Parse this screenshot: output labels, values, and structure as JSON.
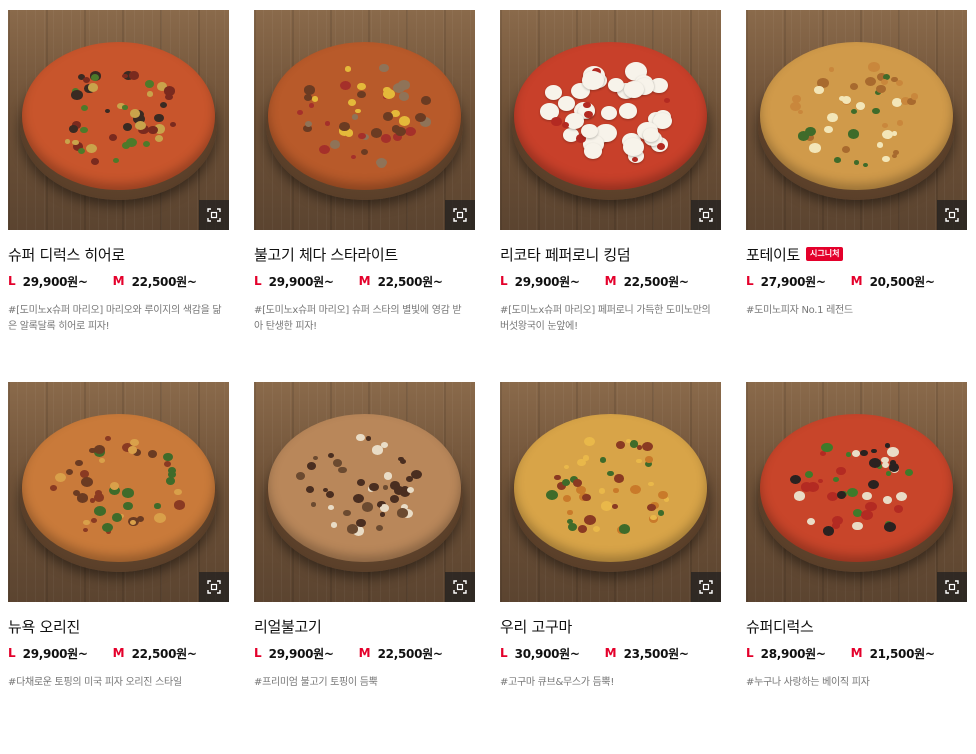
{
  "colors": {
    "accent": "#e4002b",
    "text": "#111111",
    "muted": "#777777",
    "zoom_button": "#2b2b2b"
  },
  "icons": {
    "zoom": "zoom-frame-icon"
  },
  "products": [
    {
      "name": "슈퍼 디럭스 히어로",
      "badge": "",
      "size_l": "L",
      "price_l": "29,900원~",
      "size_m": "M",
      "price_m": "22,500원~",
      "desc": "#[도미노x슈퍼 마리오] 마리오와 루이지의 색감을 닮은 알록달록 히어로 피자!",
      "sauce": "#c8552c",
      "tops": [
        "#3a2a22",
        "#7a2a1e",
        "#4d7a2a",
        "#c9a34b"
      ]
    },
    {
      "name": "불고기 체다 스타라이트",
      "badge": "",
      "size_l": "L",
      "price_l": "29,900원~",
      "size_m": "M",
      "price_m": "22,500원~",
      "desc": "#[도미노x슈퍼 마리오] 슈퍼 스타의 별빛에 영감 받아 탄생한 피자!",
      "sauce": "#b85a2a",
      "tops": [
        "#e4b93a",
        "#6b3b22",
        "#a5302a",
        "#8f7358"
      ]
    },
    {
      "name": "리코타 페퍼로니 킹덤",
      "badge": "",
      "size_l": "L",
      "price_l": "29,900원~",
      "size_m": "M",
      "price_m": "22,500원~",
      "desc": "#[도미노x슈퍼 마리오] 페퍼로니 가득한 도미노만의 버섯왕국이 눈앞에!",
      "sauce": "#c8402a",
      "tops": [
        "#f7f3ea",
        "#f7f3ea",
        "#b32a22",
        "#f7f3ea"
      ]
    },
    {
      "name": "포테이토",
      "badge": "시그니처",
      "size_l": "L",
      "price_l": "27,900원~",
      "size_m": "M",
      "price_m": "20,500원~",
      "desc": "#도미노피자 No.1 레전드",
      "sauce": "#d09a4a",
      "tops": [
        "#c9873c",
        "#f3e6b8",
        "#a86a2e",
        "#3f6b2a"
      ]
    },
    {
      "name": "뉴욕 오리진",
      "badge": "",
      "size_l": "L",
      "price_l": "29,900원~",
      "size_m": "M",
      "price_m": "22,500원~",
      "desc": "#다채로운 토핑의 미국 피자 오리진 스타일",
      "sauce": "#c97a3a",
      "tops": [
        "#8a3a22",
        "#3f6b2a",
        "#d9a04a",
        "#6b3b22"
      ]
    },
    {
      "name": "리얼불고기",
      "badge": "",
      "size_l": "L",
      "price_l": "29,900원~",
      "size_m": "M",
      "price_m": "22,500원~",
      "desc": "#프리미엄 불고기 토핑이 듬뿍",
      "sauce": "#b9875a",
      "tops": [
        "#4a2e20",
        "#e9dcc6",
        "#6b4a30",
        "#4a2e20"
      ]
    },
    {
      "name": "우리 고구마",
      "badge": "",
      "size_l": "L",
      "price_l": "30,900원~",
      "size_m": "M",
      "price_m": "23,500원~",
      "desc": "#고구마 큐브&무스가 듬뿍!",
      "sauce": "#d8a448",
      "tops": [
        "#e9b84a",
        "#8a3a22",
        "#c97a2a",
        "#3f6b2a"
      ]
    },
    {
      "name": "슈퍼디럭스",
      "badge": "",
      "size_l": "L",
      "price_l": "28,900원~",
      "size_m": "M",
      "price_m": "21,500원~",
      "desc": "#누구나 사랑하는 베이직 피자",
      "sauce": "#c8452a",
      "tops": [
        "#2a2220",
        "#b32a22",
        "#3f7a2a",
        "#e9dcc6"
      ]
    }
  ]
}
